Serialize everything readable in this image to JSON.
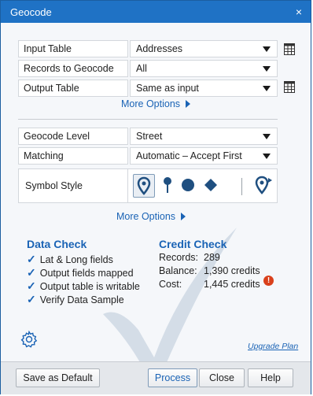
{
  "window": {
    "title": "Geocode"
  },
  "fields": [
    {
      "label": "Input Table",
      "value": "Addresses"
    },
    {
      "label": "Records to Geocode",
      "value": "All"
    },
    {
      "label": "Output Table",
      "value": "Same as input"
    }
  ],
  "more_options_1": "More Options",
  "fields2": [
    {
      "label": "Geocode Level",
      "value": "Street"
    },
    {
      "label": "Matching",
      "value": "Automatic – Accept First"
    }
  ],
  "symbol_style": {
    "label": "Symbol Style"
  },
  "more_options_2": "More Options",
  "data_check": {
    "title": "Data Check",
    "items": [
      "Lat & Long fields",
      "Output fields mapped",
      "Output table is writable",
      "Verify Data Sample"
    ]
  },
  "credit_check": {
    "title": "Credit Check",
    "rows": [
      {
        "label": "Records:",
        "value": "289"
      },
      {
        "label": "Balance:",
        "value": "1,390 credits"
      },
      {
        "label": "Cost:",
        "value": "1,445 credits"
      }
    ],
    "warning_glyph": "!"
  },
  "upgrade_link": "Upgrade Plan",
  "footer": {
    "save_default": "Save as Default",
    "process": "Process",
    "close": "Close",
    "help": "Help"
  },
  "colors": {
    "accent": "#1a63b5",
    "titlebar": "#1f72c5",
    "warning": "#d9401b"
  }
}
